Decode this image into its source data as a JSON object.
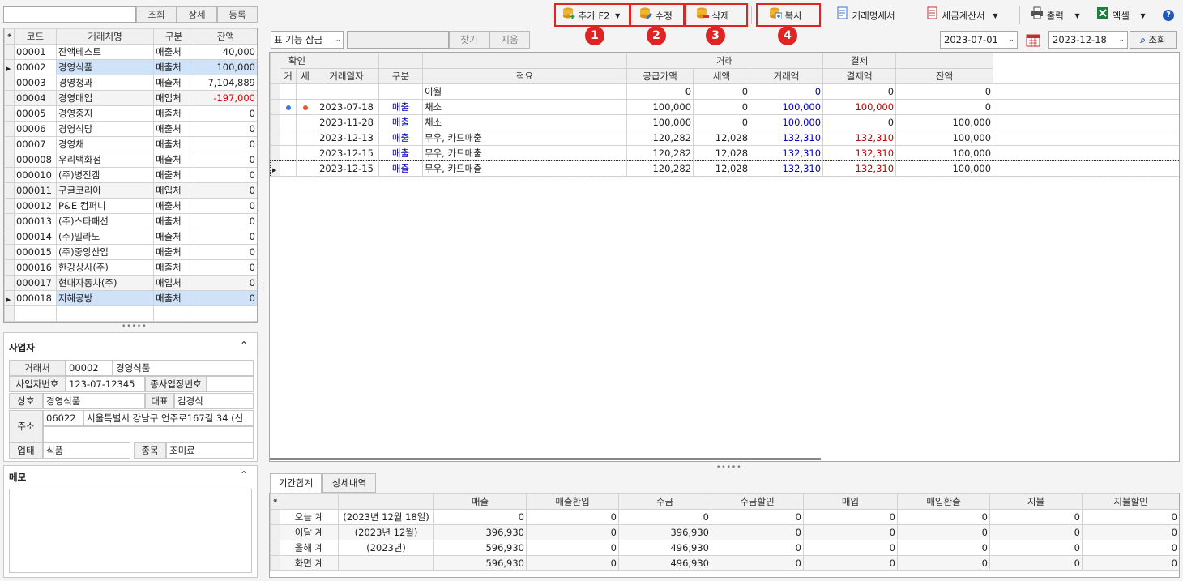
{
  "left": {
    "search_value": "",
    "buttons": [
      "조회",
      "상세",
      "등록"
    ],
    "table": {
      "headers": [
        "코드",
        "거래처명",
        "구분",
        "잔액"
      ],
      "rows": [
        {
          "code": "00001",
          "name": "잔액테스트",
          "type": "매출처",
          "balance": "40,000"
        },
        {
          "code": "00002",
          "name": "경영식품",
          "type": "매출처",
          "balance": "100,000"
        },
        {
          "code": "00003",
          "name": "경영청과",
          "type": "매출처",
          "balance": "7,104,889"
        },
        {
          "code": "00004",
          "name": "경영매입",
          "type": "매입처",
          "balance": "-197,000"
        },
        {
          "code": "00005",
          "name": "경영중지",
          "type": "매출처",
          "balance": "0"
        },
        {
          "code": "00006",
          "name": "경영식당",
          "type": "매출처",
          "balance": "0"
        },
        {
          "code": "00007",
          "name": "경영채",
          "type": "매출처",
          "balance": "0"
        },
        {
          "code": "000008",
          "name": "우리백화점",
          "type": "매출처",
          "balance": "0"
        },
        {
          "code": "000010",
          "name": "(주)병진캠",
          "type": "매출처",
          "balance": "0"
        },
        {
          "code": "000011",
          "name": "구글코리아",
          "type": "매입처",
          "balance": "0"
        },
        {
          "code": "000012",
          "name": "P&E 컴퍼니",
          "type": "매출처",
          "balance": "0"
        },
        {
          "code": "000013",
          "name": "(주)스타패션",
          "type": "매출처",
          "balance": "0"
        },
        {
          "code": "000014",
          "name": "(주)밀라노",
          "type": "매출처",
          "balance": "0"
        },
        {
          "code": "000015",
          "name": "(주)중앙산업",
          "type": "매출처",
          "balance": "0"
        },
        {
          "code": "000016",
          "name": "한강상사(주)",
          "type": "매출처",
          "balance": "0"
        },
        {
          "code": "000017",
          "name": "현대자동차(주)",
          "type": "매입처",
          "balance": "0"
        },
        {
          "code": "000018",
          "name": "지혜공방",
          "type": "매출처",
          "balance": "0"
        }
      ]
    },
    "business": {
      "title": "사업자",
      "fields": {
        "client_label": "거래처",
        "client_code": "00002",
        "client_name": "경영식품",
        "bizno_label": "사업자번호",
        "bizno": "123-07-12345",
        "subbiz_label": "종사업장번호",
        "subbiz": "",
        "company_label": "상호",
        "company": "경영식품",
        "ceo_label": "대표",
        "ceo": "김경식",
        "addr_label": "주소",
        "zip": "06022",
        "addr": "서울특별시 강남구 언주로167길 34 (신",
        "biztype_label": "업태",
        "biztype": "식품",
        "item_label": "종목",
        "item": "조미료"
      }
    },
    "memo": {
      "title": "메모",
      "text": ""
    }
  },
  "toolbar": {
    "add": "추가 F2",
    "edit": "수정",
    "delete": "삭제",
    "copy": "복사",
    "statement": "거래명세서",
    "taxinvoice": "세금계산서",
    "print": "출력",
    "excel": "엑셀",
    "badges": [
      "1",
      "2",
      "3",
      "4"
    ]
  },
  "filter": {
    "lock_label": "표 기능 잠금",
    "search_value": "",
    "find": "찾기",
    "clear": "지움",
    "date_from": "2023-07-01",
    "date_to": "2023-12-18",
    "search": "조회"
  },
  "main": {
    "group_headers": {
      "confirm": "확인",
      "trade": "거래",
      "settle": "결제"
    },
    "headers": {
      "geo": "거",
      "se": "세",
      "date": "거래일자",
      "type": "구분",
      "memo": "적요",
      "supply": "공급가액",
      "tax": "세액",
      "amount": "거래액",
      "paid": "결제액",
      "balance": "잔액"
    },
    "rows": [
      {
        "geo": "",
        "se": "",
        "date": "",
        "type": "",
        "memo": "이월",
        "supply": "0",
        "tax": "0",
        "amount": "0",
        "paid": "0",
        "balance": "0"
      },
      {
        "geo": "blue-dot",
        "se": "red-dot",
        "date": "2023-07-18",
        "type": "매출",
        "memo": "채소",
        "supply": "100,000",
        "tax": "0",
        "amount": "100,000",
        "paid": "100,000",
        "balance": "0"
      },
      {
        "geo": "",
        "se": "",
        "date": "2023-11-28",
        "type": "매출",
        "memo": "채소",
        "supply": "100,000",
        "tax": "0",
        "amount": "100,000",
        "paid": "0",
        "balance": "100,000"
      },
      {
        "geo": "",
        "se": "",
        "date": "2023-12-13",
        "type": "매출",
        "memo": "무우, 카드매출",
        "supply": "120,282",
        "tax": "12,028",
        "amount": "132,310",
        "paid": "132,310",
        "balance": "100,000"
      },
      {
        "geo": "",
        "se": "",
        "date": "2023-12-15",
        "type": "매출",
        "memo": "무우, 카드매출",
        "supply": "120,282",
        "tax": "12,028",
        "amount": "132,310",
        "paid": "132,310",
        "balance": "100,000"
      },
      {
        "geo": "",
        "se": "",
        "date": "2023-12-15",
        "type": "매출",
        "memo": "무우, 카드매출",
        "supply": "120,282",
        "tax": "12,028",
        "amount": "132,310",
        "paid": "132,310",
        "balance": "100,000"
      }
    ]
  },
  "tabs": [
    "기간합계",
    "상세내역"
  ],
  "summary": {
    "headers": [
      "매출",
      "매출환입",
      "수금",
      "수금할인",
      "매입",
      "매입환출",
      "지불",
      "지불할인"
    ],
    "rows": [
      {
        "label": "오늘 계",
        "period": "(2023년 12월 18일)",
        "values": [
          "0",
          "0",
          "0",
          "0",
          "0",
          "0",
          "0",
          "0"
        ]
      },
      {
        "label": "이달 계",
        "period": "(2023년 12월)",
        "values": [
          "396,930",
          "0",
          "396,930",
          "0",
          "0",
          "0",
          "0",
          "0"
        ]
      },
      {
        "label": "올해 계",
        "period": "(2023년)",
        "values": [
          "596,930",
          "0",
          "496,930",
          "0",
          "0",
          "0",
          "0",
          "0"
        ]
      },
      {
        "label": "화면 계",
        "period": "",
        "values": [
          "596,930",
          "0",
          "496,930",
          "0",
          "0",
          "0",
          "0",
          "0"
        ]
      }
    ]
  },
  "colors": {
    "highlight": "#e02424",
    "selected": "#cfe2f7",
    "negative": "#d40000",
    "amount_blue": "#0000c0"
  }
}
